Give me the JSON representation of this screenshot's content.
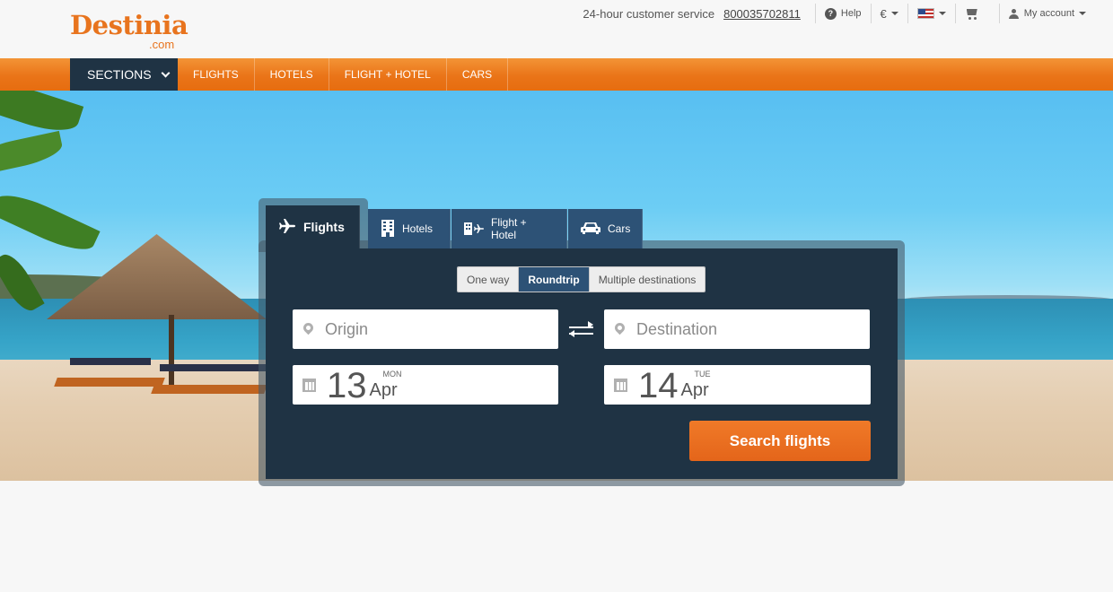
{
  "logo": {
    "main": "Destinia",
    "sub": ".com"
  },
  "header": {
    "customer_service_label": "24-hour customer service",
    "customer_service_phone": "800035702811",
    "help_label": "Help",
    "currency": "€",
    "account_label": "My account"
  },
  "nav": {
    "sections_label": "SECTIONS",
    "items": [
      "FLIGHTS",
      "HOTELS",
      "FLIGHT + HOTEL",
      "CARS"
    ]
  },
  "search": {
    "tabs": [
      "Flights",
      "Hotels",
      "Flight + Hotel",
      "Cars"
    ],
    "active_tab": "Flights",
    "trip_types": [
      "One way",
      "Roundtrip",
      "Multiple destinations"
    ],
    "selected_trip_type": "Roundtrip",
    "origin_placeholder": "Origin",
    "destination_placeholder": "Destination",
    "depart": {
      "day": "13",
      "weekday": "MON",
      "month": "Apr"
    },
    "return": {
      "day": "14",
      "weekday": "TUE",
      "month": "Apr"
    },
    "submit_label": "Search flights"
  },
  "colors": {
    "brand_orange": "#e8741e",
    "navy": "#1f3344",
    "tab_blue": "#2d5276"
  }
}
